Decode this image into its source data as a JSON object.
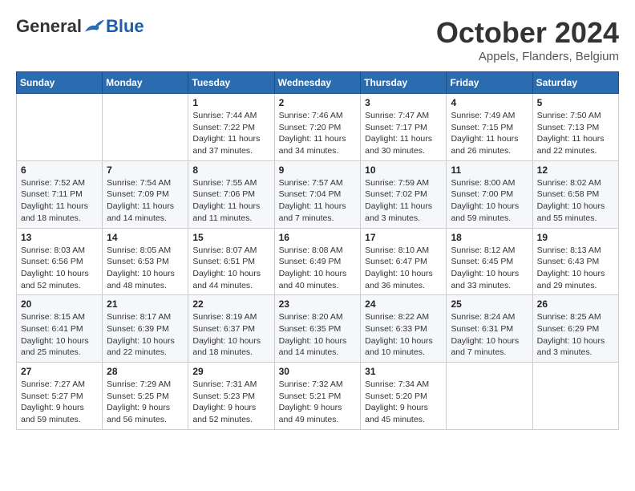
{
  "logo": {
    "general": "General",
    "blue": "Blue"
  },
  "header": {
    "month": "October 2024",
    "location": "Appels, Flanders, Belgium"
  },
  "weekdays": [
    "Sunday",
    "Monday",
    "Tuesday",
    "Wednesday",
    "Thursday",
    "Friday",
    "Saturday"
  ],
  "weeks": [
    [
      {
        "day": "",
        "info": ""
      },
      {
        "day": "",
        "info": ""
      },
      {
        "day": "1",
        "info": "Sunrise: 7:44 AM\nSunset: 7:22 PM\nDaylight: 11 hours\nand 37 minutes."
      },
      {
        "day": "2",
        "info": "Sunrise: 7:46 AM\nSunset: 7:20 PM\nDaylight: 11 hours\nand 34 minutes."
      },
      {
        "day": "3",
        "info": "Sunrise: 7:47 AM\nSunset: 7:17 PM\nDaylight: 11 hours\nand 30 minutes."
      },
      {
        "day": "4",
        "info": "Sunrise: 7:49 AM\nSunset: 7:15 PM\nDaylight: 11 hours\nand 26 minutes."
      },
      {
        "day": "5",
        "info": "Sunrise: 7:50 AM\nSunset: 7:13 PM\nDaylight: 11 hours\nand 22 minutes."
      }
    ],
    [
      {
        "day": "6",
        "info": "Sunrise: 7:52 AM\nSunset: 7:11 PM\nDaylight: 11 hours\nand 18 minutes."
      },
      {
        "day": "7",
        "info": "Sunrise: 7:54 AM\nSunset: 7:09 PM\nDaylight: 11 hours\nand 14 minutes."
      },
      {
        "day": "8",
        "info": "Sunrise: 7:55 AM\nSunset: 7:06 PM\nDaylight: 11 hours\nand 11 minutes."
      },
      {
        "day": "9",
        "info": "Sunrise: 7:57 AM\nSunset: 7:04 PM\nDaylight: 11 hours\nand 7 minutes."
      },
      {
        "day": "10",
        "info": "Sunrise: 7:59 AM\nSunset: 7:02 PM\nDaylight: 11 hours\nand 3 minutes."
      },
      {
        "day": "11",
        "info": "Sunrise: 8:00 AM\nSunset: 7:00 PM\nDaylight: 10 hours\nand 59 minutes."
      },
      {
        "day": "12",
        "info": "Sunrise: 8:02 AM\nSunset: 6:58 PM\nDaylight: 10 hours\nand 55 minutes."
      }
    ],
    [
      {
        "day": "13",
        "info": "Sunrise: 8:03 AM\nSunset: 6:56 PM\nDaylight: 10 hours\nand 52 minutes."
      },
      {
        "day": "14",
        "info": "Sunrise: 8:05 AM\nSunset: 6:53 PM\nDaylight: 10 hours\nand 48 minutes."
      },
      {
        "day": "15",
        "info": "Sunrise: 8:07 AM\nSunset: 6:51 PM\nDaylight: 10 hours\nand 44 minutes."
      },
      {
        "day": "16",
        "info": "Sunrise: 8:08 AM\nSunset: 6:49 PM\nDaylight: 10 hours\nand 40 minutes."
      },
      {
        "day": "17",
        "info": "Sunrise: 8:10 AM\nSunset: 6:47 PM\nDaylight: 10 hours\nand 36 minutes."
      },
      {
        "day": "18",
        "info": "Sunrise: 8:12 AM\nSunset: 6:45 PM\nDaylight: 10 hours\nand 33 minutes."
      },
      {
        "day": "19",
        "info": "Sunrise: 8:13 AM\nSunset: 6:43 PM\nDaylight: 10 hours\nand 29 minutes."
      }
    ],
    [
      {
        "day": "20",
        "info": "Sunrise: 8:15 AM\nSunset: 6:41 PM\nDaylight: 10 hours\nand 25 minutes."
      },
      {
        "day": "21",
        "info": "Sunrise: 8:17 AM\nSunset: 6:39 PM\nDaylight: 10 hours\nand 22 minutes."
      },
      {
        "day": "22",
        "info": "Sunrise: 8:19 AM\nSunset: 6:37 PM\nDaylight: 10 hours\nand 18 minutes."
      },
      {
        "day": "23",
        "info": "Sunrise: 8:20 AM\nSunset: 6:35 PM\nDaylight: 10 hours\nand 14 minutes."
      },
      {
        "day": "24",
        "info": "Sunrise: 8:22 AM\nSunset: 6:33 PM\nDaylight: 10 hours\nand 10 minutes."
      },
      {
        "day": "25",
        "info": "Sunrise: 8:24 AM\nSunset: 6:31 PM\nDaylight: 10 hours\nand 7 minutes."
      },
      {
        "day": "26",
        "info": "Sunrise: 8:25 AM\nSunset: 6:29 PM\nDaylight: 10 hours\nand 3 minutes."
      }
    ],
    [
      {
        "day": "27",
        "info": "Sunrise: 7:27 AM\nSunset: 5:27 PM\nDaylight: 9 hours\nand 59 minutes."
      },
      {
        "day": "28",
        "info": "Sunrise: 7:29 AM\nSunset: 5:25 PM\nDaylight: 9 hours\nand 56 minutes."
      },
      {
        "day": "29",
        "info": "Sunrise: 7:31 AM\nSunset: 5:23 PM\nDaylight: 9 hours\nand 52 minutes."
      },
      {
        "day": "30",
        "info": "Sunrise: 7:32 AM\nSunset: 5:21 PM\nDaylight: 9 hours\nand 49 minutes."
      },
      {
        "day": "31",
        "info": "Sunrise: 7:34 AM\nSunset: 5:20 PM\nDaylight: 9 hours\nand 45 minutes."
      },
      {
        "day": "",
        "info": ""
      },
      {
        "day": "",
        "info": ""
      }
    ]
  ]
}
